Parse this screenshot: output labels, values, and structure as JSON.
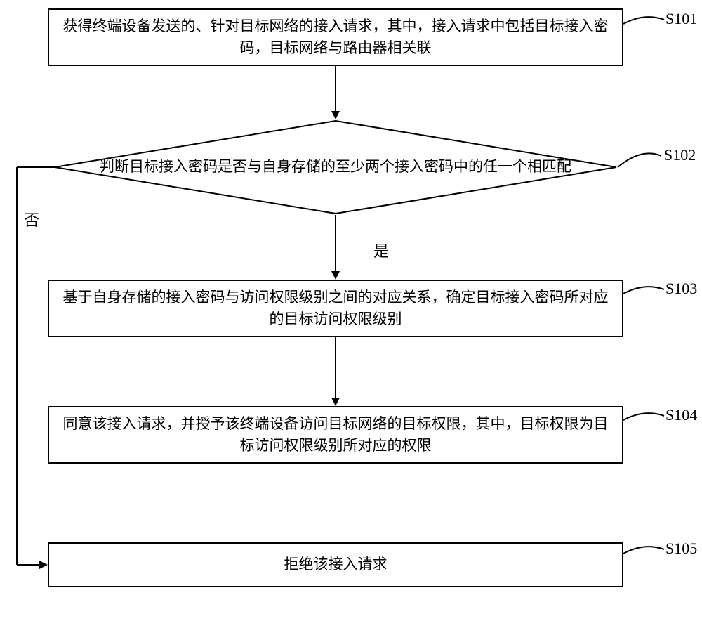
{
  "chart_data": {
    "type": "flowchart",
    "title": "",
    "nodes": [
      {
        "id": "S101",
        "shape": "rect",
        "text": "获得终端设备发送的、针对目标网络的接入请求，其中，接入请求中包括目标接入密码，目标网络与路由器相关联"
      },
      {
        "id": "S102",
        "shape": "decision",
        "text": "判断目标接入密码是否与自身存储的至少两个接入密码中的任一个相匹配"
      },
      {
        "id": "S103",
        "shape": "rect",
        "text": "基于自身存储的接入密码与访问权限级别之间的对应关系，确定目标接入密码所对应的目标访问权限级别"
      },
      {
        "id": "S104",
        "shape": "rect",
        "text": "同意该接入请求，并授予该终端设备访问目标网络的目标权限，其中，目标权限为目标访问权限级别所对应的权限"
      },
      {
        "id": "S105",
        "shape": "rect",
        "text": "拒绝该接入请求"
      }
    ],
    "edges": [
      {
        "from": "S101",
        "to": "S102",
        "label": ""
      },
      {
        "from": "S102",
        "to": "S103",
        "label": "是"
      },
      {
        "from": "S102",
        "to": "S105",
        "label": "否"
      },
      {
        "from": "S103",
        "to": "S104",
        "label": ""
      }
    ],
    "labels": {
      "s101": "S101",
      "s102": "S102",
      "s103": "S103",
      "s104": "S104",
      "s105": "S105",
      "yes": "是",
      "no": "否"
    }
  }
}
